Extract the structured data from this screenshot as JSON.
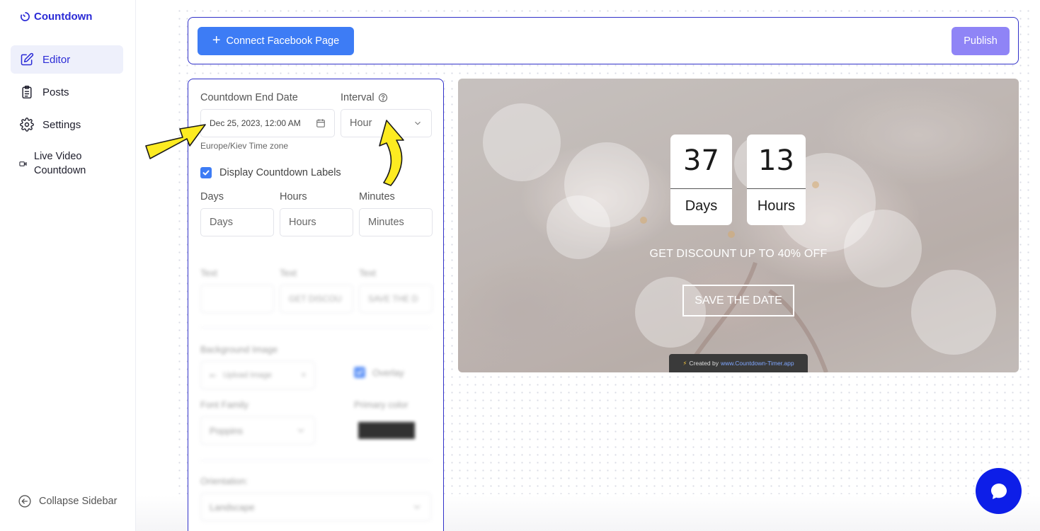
{
  "app": {
    "name": "Countdown",
    "brand_color": "#2b2bd6"
  },
  "sidebar": {
    "items": [
      {
        "label": "Editor",
        "icon": "edit-icon",
        "active": true
      },
      {
        "label": "Posts",
        "icon": "clipboard-icon"
      },
      {
        "label": "Settings",
        "icon": "gear-icon"
      },
      {
        "label": "Live Video Countdown",
        "icon": "video-icon"
      }
    ],
    "collapse_label": "Collapse Sidebar"
  },
  "topbar": {
    "connect_label": "Connect Facebook Page",
    "publish_label": "Publish",
    "connect_color": "#3d7cf5",
    "publish_color": "#8f84f6"
  },
  "form": {
    "end_date_label": "Countdown End Date",
    "end_date_value": "Dec 25, 2023, 12:00 AM",
    "interval_label": "Interval",
    "interval_value": "Hour",
    "timezone": "Europe/Kiev Time zone",
    "display_labels_checkbox": "Display Countdown Labels",
    "display_labels_checked": true,
    "label_fields": [
      {
        "label": "Days",
        "placeholder": "Days"
      },
      {
        "label": "Hours",
        "placeholder": "Hours"
      },
      {
        "label": "Minutes",
        "placeholder": "Minutes"
      }
    ],
    "text_fields": [
      {
        "label": "Text",
        "value": ""
      },
      {
        "label": "Text",
        "value": "GET DISCOU"
      },
      {
        "label": "Text",
        "value": "SAVE THE D"
      }
    ],
    "background_image_label": "Background Image",
    "upload_label": "Upload Image",
    "overlay_label": "Overlay",
    "font_family_label": "Font Family",
    "font_family_value": "Poppins",
    "primary_color_label": "Primary color",
    "primary_color": "#000000",
    "orientation_label": "Orientation:",
    "orientation_value": "Landscape"
  },
  "preview": {
    "days_value": "37",
    "days_unit": "Days",
    "hours_value": "13",
    "hours_unit": "Hours",
    "headline": "GET DISCOUNT UP TO 40% OFF",
    "button_text": "SAVE THE DATE",
    "credit_prefix": "Created by",
    "credit_link": "www.Countdown-Timer.app"
  }
}
